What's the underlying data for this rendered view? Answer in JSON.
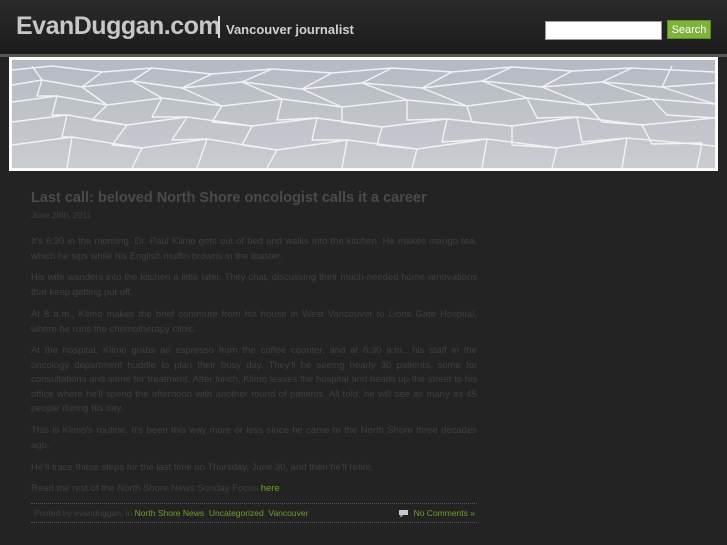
{
  "header": {
    "site_title": "EvanDuggan.com",
    "tagline": "Vancouver journalist",
    "search_placeholder": "",
    "search_button": "Search"
  },
  "post": {
    "title": "Last call: beloved North Shore oncologist calls it a career",
    "date": "June 28th, 2011",
    "paragraphs": [
      "It's 6:30 in the morning. Dr. Paul Klimo gets out of bed and walks into the kitchen. He makes mango tea, which he sips while his English muffin browns in the toaster.",
      "His wife wanders into the kitchen a little later. They chat, discussing their much-needed home renovations that keep getting put off.",
      "At 8 a.m., Klimo makes the brief commute from his house in West Vancouver to Lions Gate Hospital, where he runs the chemotherapy clinic.",
      "At the hospital, Klimo grabs an espresso from the coffee counter, and at 8:30 a.m., his staff in the oncology department huddle to plan their busy day. They'll be seeing nearly 30 patients, some for consultations and some for treatment. After lunch, Klimo leaves the hospital and heads up the street to his office where he'll spend the afternoon with another round of patients. All told, he will see as many as 45 people during his day.",
      "This is Klimo's routine. It's been this way more or less since he came to the North Shore three decades ago.",
      "He'll trace these steps for the last time on Thursday, June 30, and then he'll retire."
    ],
    "read_more_prefix": "Read the rest of the North Shore News Sunday Focus ",
    "read_more_link": "here",
    "footer": {
      "posted_by": "Posted by evanduggan, in ",
      "categories": [
        "North Shore News",
        "Uncategorized",
        "Vancouver"
      ],
      "comments": "No Comments »"
    }
  },
  "colors": {
    "background": "#232323",
    "accent_green": "#7eb23b",
    "link_green": "#6f9f2e"
  }
}
